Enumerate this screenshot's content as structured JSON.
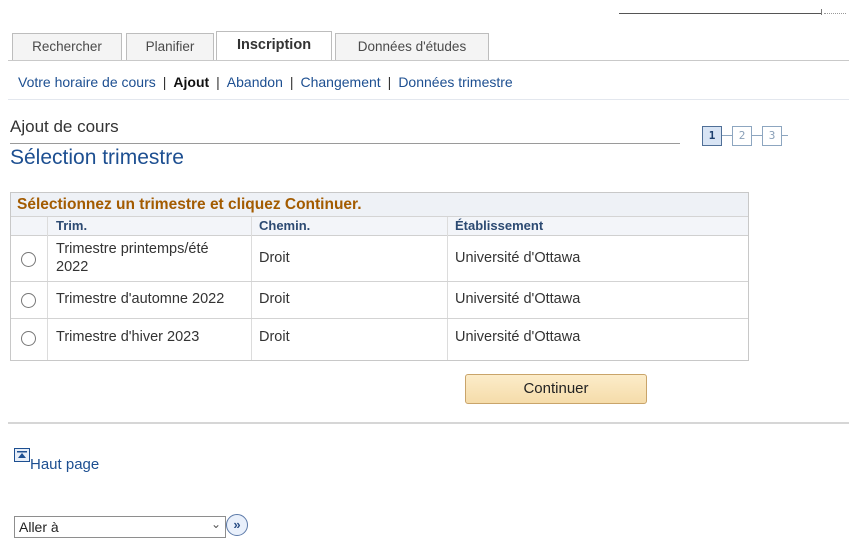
{
  "tabs": [
    {
      "label": "Rechercher",
      "active": false
    },
    {
      "label": "Planifier",
      "active": false
    },
    {
      "label": "Inscription",
      "active": true
    },
    {
      "label": "Données d'études",
      "active": false
    }
  ],
  "subnav": {
    "schedule": "Votre horaire de cours",
    "add": "Ajout",
    "drop": "Abandon",
    "swap": "Changement",
    "term_data": "Données trimestre"
  },
  "page": {
    "subtitle": "Ajout de cours",
    "title": "Sélection trimestre"
  },
  "steps": [
    "1",
    "2",
    "3"
  ],
  "grid": {
    "instruction": "Sélectionnez un trimestre et cliquez Continuer.",
    "headers": {
      "term": "Trim.",
      "career": "Chemin.",
      "institution": "Établissement"
    },
    "rows": [
      {
        "term": "Trimestre printemps/été 2022",
        "career": "Droit",
        "institution": "Université d'Ottawa"
      },
      {
        "term": "Trimestre d'automne 2022",
        "career": "Droit",
        "institution": "Université d'Ottawa"
      },
      {
        "term": "Trimestre d'hiver 2023",
        "career": "Droit",
        "institution": "Université d'Ottawa"
      }
    ]
  },
  "continue_label": "Continuer",
  "top_link": "Haut page",
  "goto": {
    "value": "Aller à"
  },
  "icons": {
    "top": "arrow-up-to-top-icon",
    "goto": "double-chevron-right-icon",
    "select": "chevron-down-icon"
  },
  "colors": {
    "accent_blue": "#1d4f91",
    "instruction_orange": "#a35b00",
    "button_bg": "#f8e2b6"
  }
}
